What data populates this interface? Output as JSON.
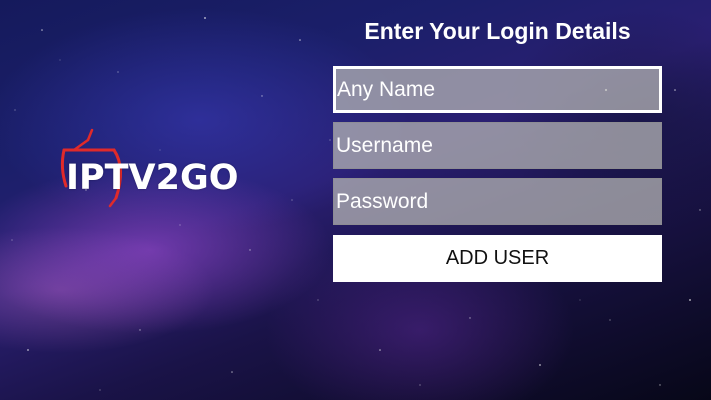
{
  "brand": {
    "logo_text": "IPTV2GO",
    "logo_accent_color": "#e02a2a"
  },
  "form": {
    "title": "Enter Your Login Details",
    "fields": [
      {
        "placeholder": "Any Name",
        "focused": true
      },
      {
        "placeholder": "Username",
        "focused": false
      },
      {
        "placeholder": "Password",
        "focused": false
      }
    ],
    "submit_label": "ADD USER"
  },
  "colors": {
    "field_bg": "#b4b4b4",
    "button_bg": "#ffffff",
    "text": "#ffffff"
  }
}
